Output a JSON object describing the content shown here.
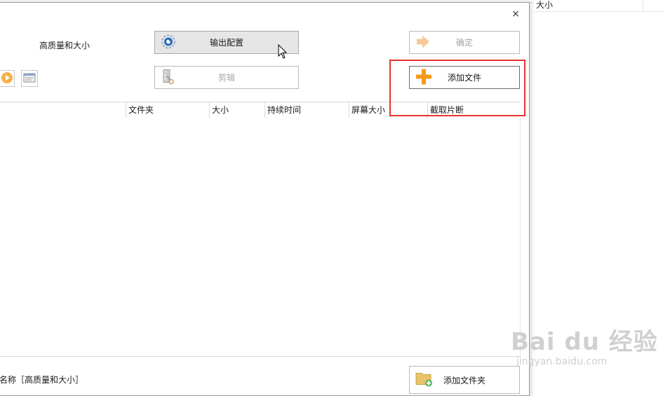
{
  "background_window": {
    "column_size": "大小"
  },
  "dialog": {
    "close_glyph": "×",
    "quality_label": "高质量和大小",
    "buttons": {
      "output_config": "输出配置",
      "edit": "剪辑",
      "ok": "确定",
      "add_file": "添加文件",
      "add_folder": "添加文件夹"
    },
    "table": {
      "columns": [
        "文件夹",
        "大小",
        "持续时间",
        "屏幕大小",
        "截取片断"
      ]
    },
    "profile_name": "名称［高质量和大小］"
  },
  "colors": {
    "highlight": "#e5322d",
    "plus_icon": "#f39a1e",
    "gear_icon": "#2a6bb5",
    "folder_icon": "#e8c46a"
  },
  "icons": [
    "gear-icon",
    "film-scissors-icon",
    "arrow-right-icon",
    "plus-icon",
    "folder-add-icon",
    "play-icon",
    "card-icon",
    "close-icon",
    "mouse-cursor-icon"
  ],
  "watermark": {
    "brand": "Bai du 经验",
    "url": "jingyan.baidu.com"
  }
}
